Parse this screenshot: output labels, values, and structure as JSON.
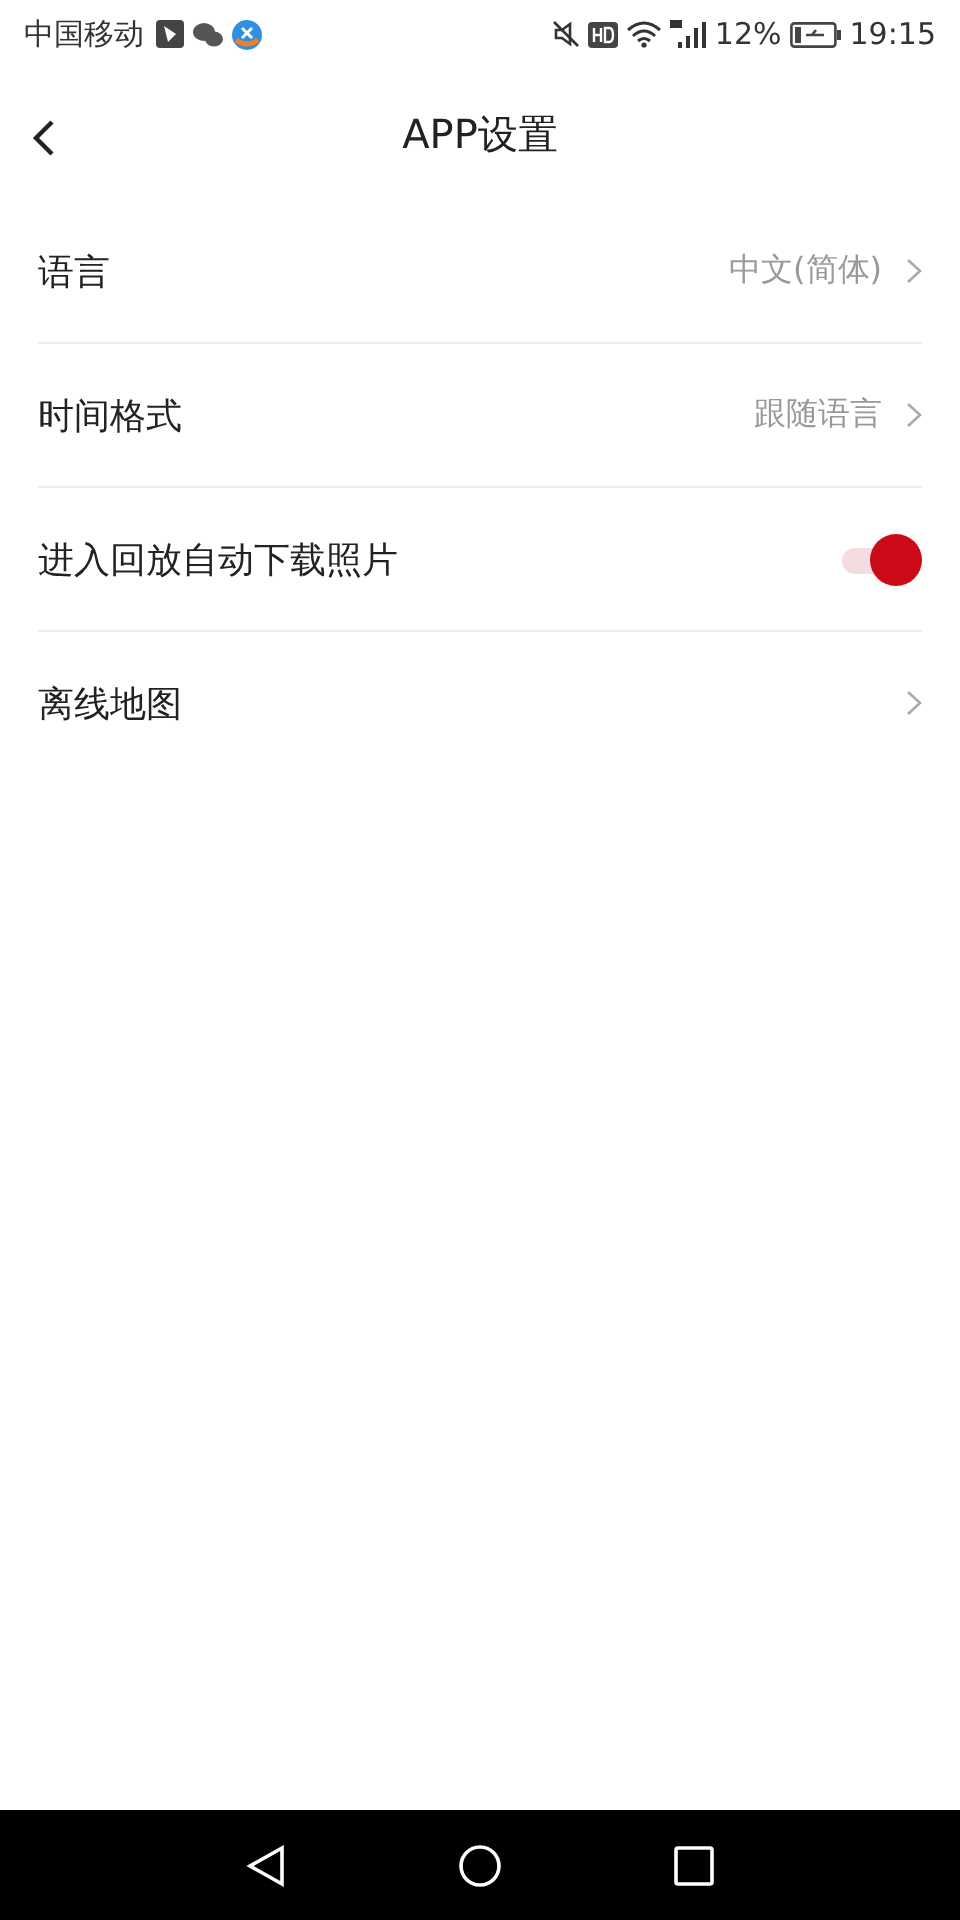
{
  "status_bar": {
    "carrier": "中国移动",
    "battery_percent": "12%",
    "time": "19:15"
  },
  "header": {
    "title": "APP设置"
  },
  "settings": [
    {
      "kind": "link",
      "label": "语言",
      "value": "中文(简体)"
    },
    {
      "kind": "link",
      "label": "时间格式",
      "value": "跟随语言"
    },
    {
      "kind": "toggle",
      "label": "进入回放自动下载照片",
      "on": true
    },
    {
      "kind": "link",
      "label": "离线地图"
    }
  ]
}
